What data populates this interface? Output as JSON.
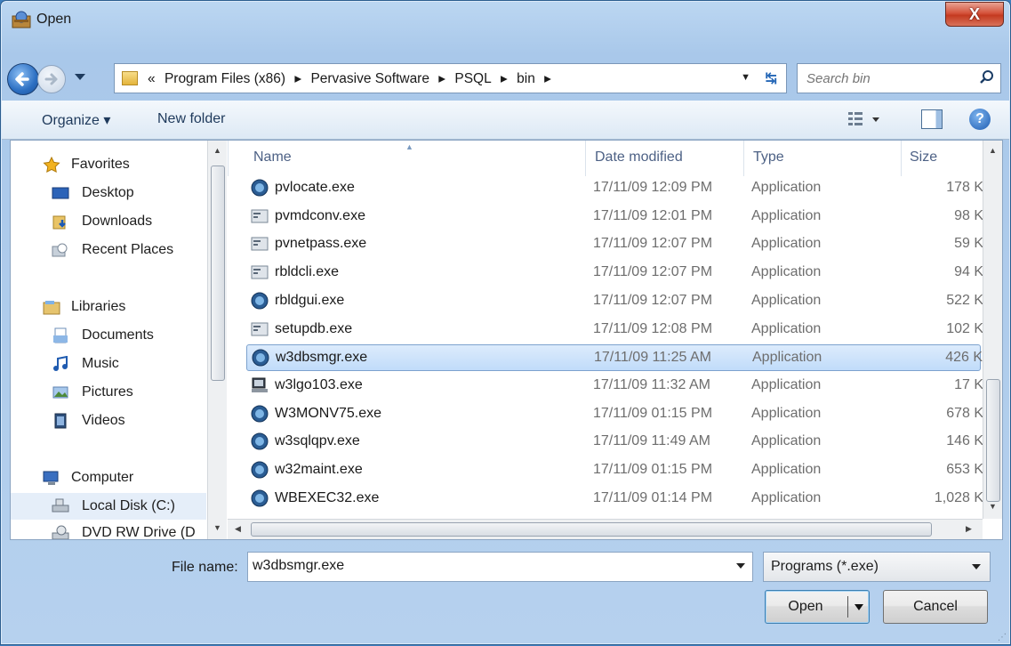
{
  "window": {
    "title": "Open",
    "close_label": "X"
  },
  "nav": {
    "breadcrumbs": [
      "«",
      "Program Files (x86)",
      "▸",
      "Pervasive Software",
      "▸",
      "PSQL",
      "▸",
      "bin",
      "▸"
    ],
    "search_placeholder": "Search bin"
  },
  "toolbar": {
    "organize_label": "Organize ▾",
    "new_folder_label": "New folder",
    "help_label": "?"
  },
  "sidebar": {
    "items": [
      {
        "label": "Favorites",
        "icon": "star-icon"
      },
      {
        "label": "Desktop",
        "icon": "desktop-icon"
      },
      {
        "label": "Downloads",
        "icon": "downloads-icon"
      },
      {
        "label": "Recent Places",
        "icon": "recent-places-icon"
      },
      {
        "label": "Libraries",
        "icon": "libraries-icon"
      },
      {
        "label": "Documents",
        "icon": "documents-icon"
      },
      {
        "label": "Music",
        "icon": "music-icon"
      },
      {
        "label": "Pictures",
        "icon": "pictures-icon"
      },
      {
        "label": "Videos",
        "icon": "videos-icon"
      },
      {
        "label": "Computer",
        "icon": "computer-icon"
      },
      {
        "label": "Local Disk (C:)",
        "icon": "local-disk-icon"
      },
      {
        "label": "DVD RW Drive (D",
        "icon": "dvd-drive-icon"
      }
    ]
  },
  "files": {
    "columns": [
      "Name",
      "Date modified",
      "Type",
      "Size"
    ],
    "rows": [
      {
        "name": "pvlocate.exe",
        "date": "17/11/09 12:09 PM",
        "type": "Application",
        "size": "178 K",
        "icon": "pervasive-app-icon"
      },
      {
        "name": "pvmdconv.exe",
        "date": "17/11/09 12:01 PM",
        "type": "Application",
        "size": "98 K",
        "icon": "console-app-icon"
      },
      {
        "name": "pvnetpass.exe",
        "date": "17/11/09 12:07 PM",
        "type": "Application",
        "size": "59 K",
        "icon": "console-app-icon"
      },
      {
        "name": "rbldcli.exe",
        "date": "17/11/09 12:07 PM",
        "type": "Application",
        "size": "94 K",
        "icon": "console-app-icon"
      },
      {
        "name": "rbldgui.exe",
        "date": "17/11/09 12:07 PM",
        "type": "Application",
        "size": "522 K",
        "icon": "pervasive-app-icon"
      },
      {
        "name": "setupdb.exe",
        "date": "17/11/09 12:08 PM",
        "type": "Application",
        "size": "102 K",
        "icon": "console-app-icon"
      },
      {
        "name": "w3dbsmgr.exe",
        "date": "17/11/09 11:25 AM",
        "type": "Application",
        "size": "426 K",
        "icon": "pervasive-app-icon"
      },
      {
        "name": "w3lgo103.exe",
        "date": "17/11/09 11:32 AM",
        "type": "Application",
        "size": "17 K",
        "icon": "computer-app-icon"
      },
      {
        "name": "W3MONV75.exe",
        "date": "17/11/09 01:15 PM",
        "type": "Application",
        "size": "678 K",
        "icon": "pervasive-app-icon"
      },
      {
        "name": "w3sqlqpv.exe",
        "date": "17/11/09 11:49 AM",
        "type": "Application",
        "size": "146 K",
        "icon": "pervasive-app-icon"
      },
      {
        "name": "w32maint.exe",
        "date": "17/11/09 01:15 PM",
        "type": "Application",
        "size": "653 K",
        "icon": "pervasive-app-icon"
      },
      {
        "name": "WBEXEC32.exe",
        "date": "17/11/09 01:14 PM",
        "type": "Application",
        "size": "1,028 K",
        "icon": "pervasive-app-icon"
      }
    ],
    "selected_index": 6
  },
  "footer": {
    "file_name_label": "File name:",
    "file_name_value": "w3dbsmgr.exe",
    "filter_value": "Programs (*.exe)",
    "open_label": "Open",
    "cancel_label": "Cancel"
  }
}
